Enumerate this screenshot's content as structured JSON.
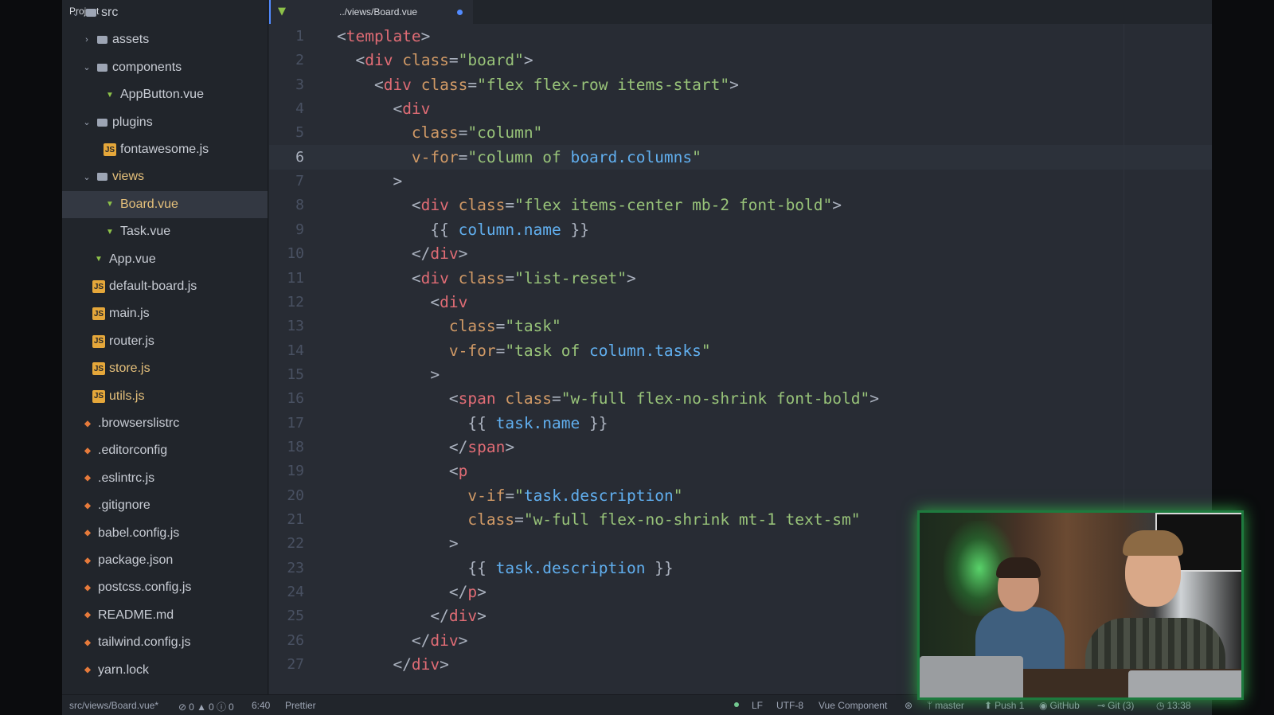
{
  "sidebar": {
    "title": "Project",
    "items": [
      {
        "label": "src",
        "type": "folder",
        "open": true,
        "depth": 0
      },
      {
        "label": "assets",
        "type": "folder",
        "open": false,
        "depth": 1
      },
      {
        "label": "components",
        "type": "folder",
        "open": true,
        "depth": 1
      },
      {
        "label": "AppButton.vue",
        "type": "vue",
        "depth": 2
      },
      {
        "label": "plugins",
        "type": "folder",
        "open": true,
        "depth": 1
      },
      {
        "label": "fontawesome.js",
        "type": "js",
        "depth": 2
      },
      {
        "label": "views",
        "type": "folder",
        "open": true,
        "depth": 1,
        "status": "modified"
      },
      {
        "label": "Board.vue",
        "type": "vue",
        "depth": 2,
        "selected": true,
        "status": "modified"
      },
      {
        "label": "Task.vue",
        "type": "vue",
        "depth": 2
      },
      {
        "label": "App.vue",
        "type": "vue",
        "depth": 1
      },
      {
        "label": "default-board.js",
        "type": "js",
        "depth": 1
      },
      {
        "label": "main.js",
        "type": "js",
        "depth": 1
      },
      {
        "label": "router.js",
        "type": "js",
        "depth": 1
      },
      {
        "label": "store.js",
        "type": "js",
        "depth": 1,
        "status": "modified"
      },
      {
        "label": "utils.js",
        "type": "js",
        "depth": 1,
        "status": "modified"
      },
      {
        "label": ".browserslistrc",
        "type": "config",
        "depth": 0
      },
      {
        "label": ".editorconfig",
        "type": "config",
        "depth": 0
      },
      {
        "label": ".eslintrc.js",
        "type": "config",
        "depth": 0
      },
      {
        "label": ".gitignore",
        "type": "config",
        "depth": 0
      },
      {
        "label": "babel.config.js",
        "type": "config",
        "depth": 0
      },
      {
        "label": "package.json",
        "type": "config",
        "depth": 0
      },
      {
        "label": "postcss.config.js",
        "type": "config",
        "depth": 0
      },
      {
        "label": "README.md",
        "type": "config",
        "depth": 0
      },
      {
        "label": "tailwind.config.js",
        "type": "config",
        "depth": 0
      },
      {
        "label": "yarn.lock",
        "type": "config",
        "depth": 0
      }
    ]
  },
  "tab": {
    "title": "../views/Board.vue",
    "modified": true
  },
  "editor": {
    "cursor_line": 6,
    "lines": [
      [
        [
          "p",
          "<"
        ],
        [
          "tag",
          "template"
        ],
        [
          "p",
          ">"
        ]
      ],
      [
        [
          "p",
          "  <"
        ],
        [
          "tag",
          "div"
        ],
        [
          "p",
          " "
        ],
        [
          "attr",
          "class"
        ],
        [
          "p",
          "="
        ],
        [
          "str",
          "\"board\""
        ],
        [
          "p",
          ">"
        ]
      ],
      [
        [
          "p",
          "    <"
        ],
        [
          "tag",
          "div"
        ],
        [
          "p",
          " "
        ],
        [
          "attr",
          "class"
        ],
        [
          "p",
          "="
        ],
        [
          "str",
          "\"flex flex-row items-start\""
        ],
        [
          "p",
          ">"
        ]
      ],
      [
        [
          "p",
          "      <"
        ],
        [
          "tag",
          "div"
        ]
      ],
      [
        [
          "p",
          "        "
        ],
        [
          "attr",
          "class"
        ],
        [
          "p",
          "="
        ],
        [
          "str",
          "\"column\""
        ]
      ],
      [
        [
          "p",
          "        "
        ],
        [
          "attr",
          "v-for"
        ],
        [
          "p",
          "="
        ],
        [
          "str",
          "\"column of "
        ],
        [
          "expr",
          "board.columns"
        ],
        [
          "str",
          "\""
        ]
      ],
      [
        [
          "p",
          "      >"
        ]
      ],
      [
        [
          "p",
          "        <"
        ],
        [
          "tag",
          "div"
        ],
        [
          "p",
          " "
        ],
        [
          "attr",
          "class"
        ],
        [
          "p",
          "="
        ],
        [
          "str",
          "\"flex items-center mb-2 font-bold\""
        ],
        [
          "p",
          ">"
        ]
      ],
      [
        [
          "p",
          "          {{ "
        ],
        [
          "expr",
          "column.name"
        ],
        [
          "p",
          " }}"
        ]
      ],
      [
        [
          "p",
          "        </"
        ],
        [
          "tag",
          "div"
        ],
        [
          "p",
          ">"
        ]
      ],
      [
        [
          "p",
          "        <"
        ],
        [
          "tag",
          "div"
        ],
        [
          "p",
          " "
        ],
        [
          "attr",
          "class"
        ],
        [
          "p",
          "="
        ],
        [
          "str",
          "\"list-reset\""
        ],
        [
          "p",
          ">"
        ]
      ],
      [
        [
          "p",
          "          <"
        ],
        [
          "tag",
          "div"
        ]
      ],
      [
        [
          "p",
          "            "
        ],
        [
          "attr",
          "class"
        ],
        [
          "p",
          "="
        ],
        [
          "str",
          "\"task\""
        ]
      ],
      [
        [
          "p",
          "            "
        ],
        [
          "attr",
          "v-for"
        ],
        [
          "p",
          "="
        ],
        [
          "str",
          "\"task of "
        ],
        [
          "expr",
          "column.tasks"
        ],
        [
          "str",
          "\""
        ]
      ],
      [
        [
          "p",
          "          >"
        ]
      ],
      [
        [
          "p",
          "            <"
        ],
        [
          "tag",
          "span"
        ],
        [
          "p",
          " "
        ],
        [
          "attr",
          "class"
        ],
        [
          "p",
          "="
        ],
        [
          "str",
          "\"w-full flex-no-shrink font-bold\""
        ],
        [
          "p",
          ">"
        ]
      ],
      [
        [
          "p",
          "              {{ "
        ],
        [
          "expr",
          "task.name"
        ],
        [
          "p",
          " }}"
        ]
      ],
      [
        [
          "p",
          "            </"
        ],
        [
          "tag",
          "span"
        ],
        [
          "p",
          ">"
        ]
      ],
      [
        [
          "p",
          "            <"
        ],
        [
          "tag",
          "p"
        ]
      ],
      [
        [
          "p",
          "              "
        ],
        [
          "attr",
          "v-if"
        ],
        [
          "p",
          "="
        ],
        [
          "str",
          "\""
        ],
        [
          "expr",
          "task.description"
        ],
        [
          "str",
          "\""
        ]
      ],
      [
        [
          "p",
          "              "
        ],
        [
          "attr",
          "class"
        ],
        [
          "p",
          "="
        ],
        [
          "str",
          "\"w-full flex-no-shrink mt-1 text-sm\""
        ]
      ],
      [
        [
          "p",
          "            >"
        ]
      ],
      [
        [
          "p",
          "              {{ "
        ],
        [
          "expr",
          "task.description"
        ],
        [
          "p",
          " }}"
        ]
      ],
      [
        [
          "p",
          "            </"
        ],
        [
          "tag",
          "p"
        ],
        [
          "p",
          ">"
        ]
      ],
      [
        [
          "p",
          "          </"
        ],
        [
          "tag",
          "div"
        ],
        [
          "p",
          ">"
        ]
      ],
      [
        [
          "p",
          "        </"
        ],
        [
          "tag",
          "div"
        ],
        [
          "p",
          ">"
        ]
      ],
      [
        [
          "p",
          "      </"
        ],
        [
          "tag",
          "div"
        ],
        [
          "p",
          ">"
        ]
      ]
    ]
  },
  "statusbar": {
    "file_path": "src/views/Board.vue*",
    "errors": "0",
    "warnings": "0",
    "infos": "0",
    "cursor_position": "6:40",
    "formatter": "Prettier",
    "line_ending": "LF",
    "encoding": "UTF-8",
    "grammar": "Vue Component",
    "branch": "master",
    "push_label": "Push 1",
    "github_label": "GitHub",
    "git_label": "Git (3)",
    "clock": "13:38"
  },
  "colors": {
    "sidebar_bg": "#21252b",
    "editor_bg": "#282c34",
    "tag": "#e06c75",
    "attr": "#d19a66",
    "string": "#98c379",
    "expression": "#61afef",
    "accent": "#528bff"
  }
}
